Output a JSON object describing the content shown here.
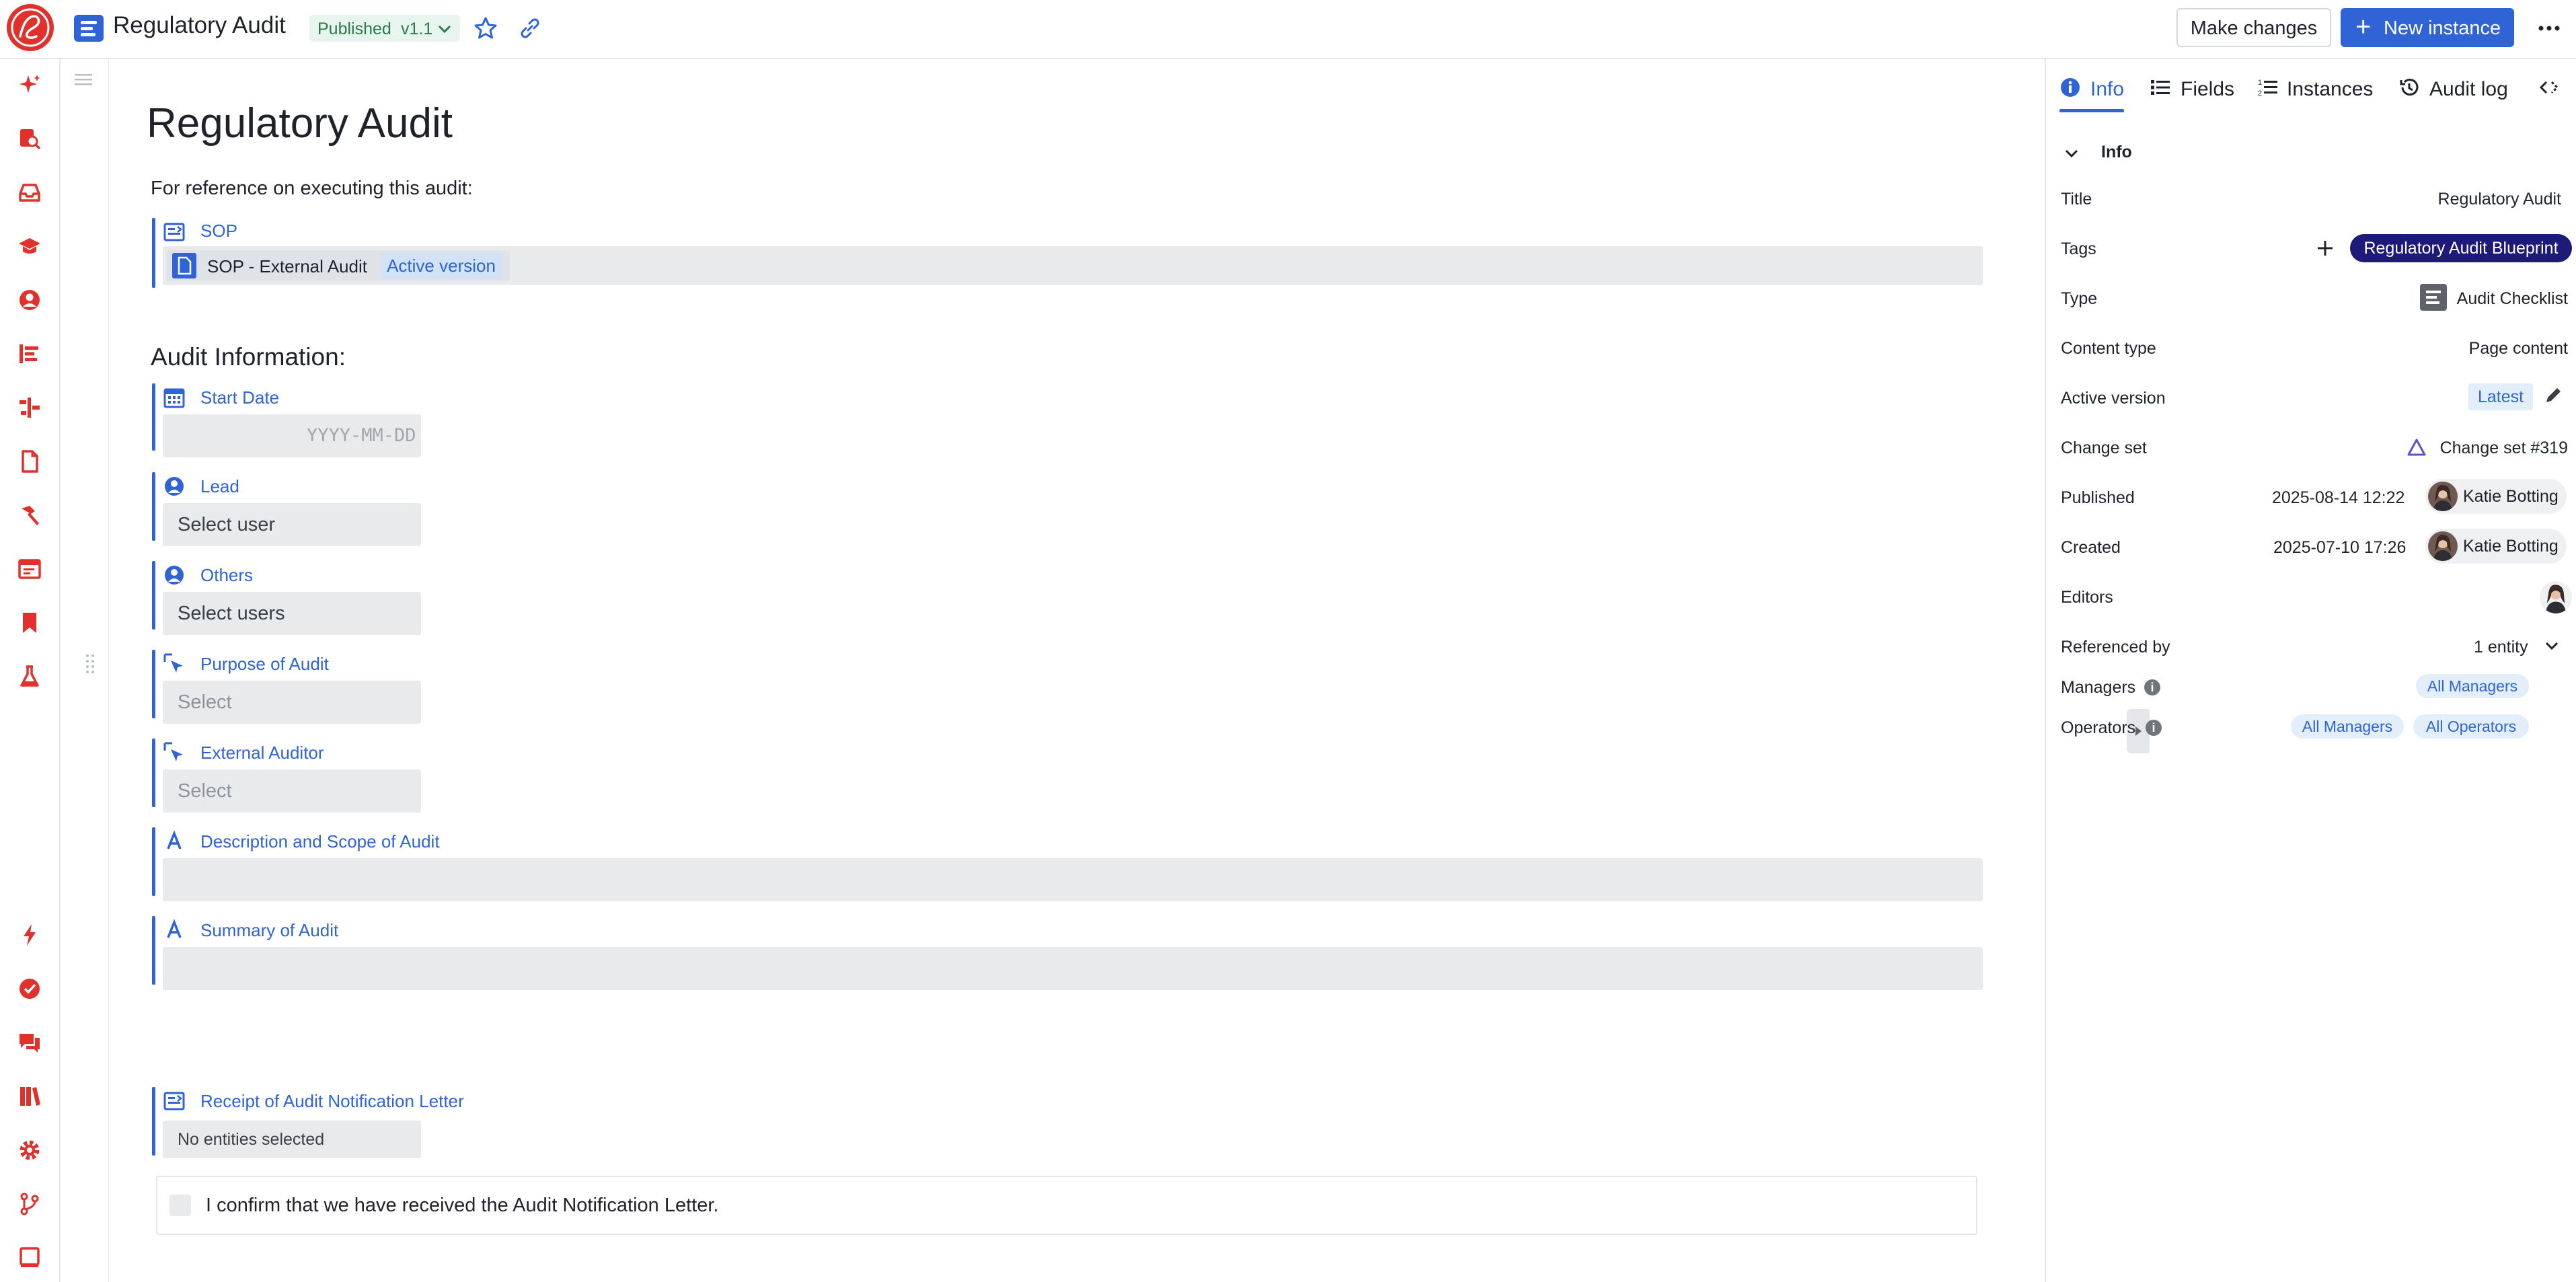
{
  "header": {
    "title": "Regulatory Audit",
    "status": "Published",
    "version": "v1.1",
    "make_changes": "Make changes",
    "new_instance": "New instance"
  },
  "page": {
    "title": "Regulatory Audit",
    "intro": "For reference on executing this audit:",
    "sop": {
      "label": "SOP",
      "doc_name": "SOP - External Audit",
      "badge": "Active version"
    },
    "section_title": "Audit Information:",
    "fields": {
      "start_date": {
        "label": "Start Date",
        "placeholder": "YYYY-MM-DD"
      },
      "lead": {
        "label": "Lead",
        "placeholder": "Select user"
      },
      "others": {
        "label": "Others",
        "placeholder": "Select users"
      },
      "purpose": {
        "label": "Purpose of Audit",
        "placeholder": "Select"
      },
      "external_auditor": {
        "label": "External Auditor",
        "placeholder": "Select"
      },
      "description": {
        "label": "Description and Scope of Audit"
      },
      "summary": {
        "label": "Summary of Audit"
      },
      "receipt": {
        "label": "Receipt of Audit Notification Letter",
        "placeholder": "No entities selected"
      }
    },
    "confirm_label": "I confirm that we have received the Audit Notification Letter."
  },
  "right_panel": {
    "tabs": [
      "Info",
      "Fields",
      "Instances",
      "Audit log"
    ],
    "section": "Info",
    "rows": {
      "title": {
        "label": "Title",
        "value": "Regulatory Audit"
      },
      "tags": {
        "label": "Tags",
        "value": "Regulatory Audit Blueprint"
      },
      "type": {
        "label": "Type",
        "value": "Audit Checklist"
      },
      "content_type": {
        "label": "Content type",
        "value": "Page content"
      },
      "active_version": {
        "label": "Active version",
        "value": "Latest"
      },
      "change_set": {
        "label": "Change set",
        "value": "Change set #319"
      },
      "published": {
        "label": "Published",
        "date": "2025-08-14 12:22",
        "user": "Katie Botting"
      },
      "created": {
        "label": "Created",
        "date": "2025-07-10 17:26",
        "user": "Katie Botting"
      },
      "editors": {
        "label": "Editors"
      },
      "referenced_by": {
        "label": "Referenced by",
        "value": "1 entity"
      },
      "managers": {
        "label": "Managers",
        "groups": [
          "All Managers"
        ]
      },
      "operators": {
        "label": "Operators",
        "groups": [
          "All Managers",
          "All Operators"
        ]
      }
    }
  },
  "colors": {
    "accent": "#2f63d6",
    "brand_red": "#e0312d",
    "tag_bg": "#1d1a7a",
    "field_bg": "#e9eaec"
  }
}
